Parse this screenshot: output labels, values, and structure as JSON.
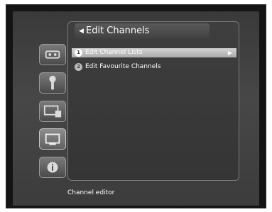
{
  "menu": {
    "title": "Edit Channels",
    "items": [
      {
        "number": "1",
        "label": "Edit Channel Lists",
        "selected": true
      },
      {
        "number": "2",
        "label": "Edit Favourite Channels",
        "selected": false
      }
    ]
  },
  "sidebar": {
    "icons": [
      "videotape-icon",
      "wrench-icon",
      "tv-settings-icon",
      "tv-icon",
      "info-icon"
    ],
    "active": "tv-icon"
  },
  "status": {
    "text": "Channel editor"
  },
  "colors": {
    "selected_highlight": "#bdbdbd",
    "panel_border": "#7a7a7a"
  }
}
